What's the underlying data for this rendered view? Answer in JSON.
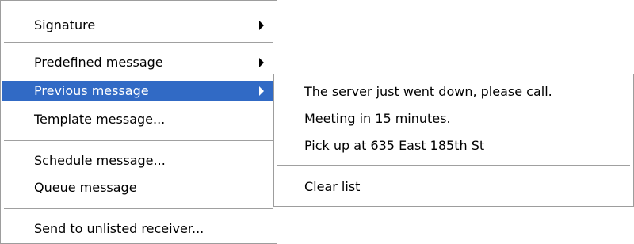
{
  "main_menu": {
    "items": [
      {
        "label": "Signature",
        "has_submenu": true
      },
      {
        "label": "Predefined message",
        "has_submenu": true
      },
      {
        "label": "Previous message",
        "has_submenu": true,
        "highlighted": true
      },
      {
        "label": "Template message...",
        "has_submenu": false
      },
      {
        "label": "Schedule message...",
        "has_submenu": false
      },
      {
        "label": "Queue message",
        "has_submenu": false
      },
      {
        "label": "Send to unlisted receiver...",
        "has_submenu": false
      }
    ]
  },
  "submenu": {
    "items": [
      {
        "label": "The server just went down, please call."
      },
      {
        "label": "Meeting in 15 minutes."
      },
      {
        "label": "Pick up at 635 East 185th St"
      },
      {
        "label": "Clear list"
      }
    ]
  },
  "colors": {
    "highlight_background": "#316ac5",
    "highlight_text": "#ffffff",
    "border": "#9d9d9d"
  },
  "icons": {
    "submenu_arrow": "triangle-right-icon"
  }
}
